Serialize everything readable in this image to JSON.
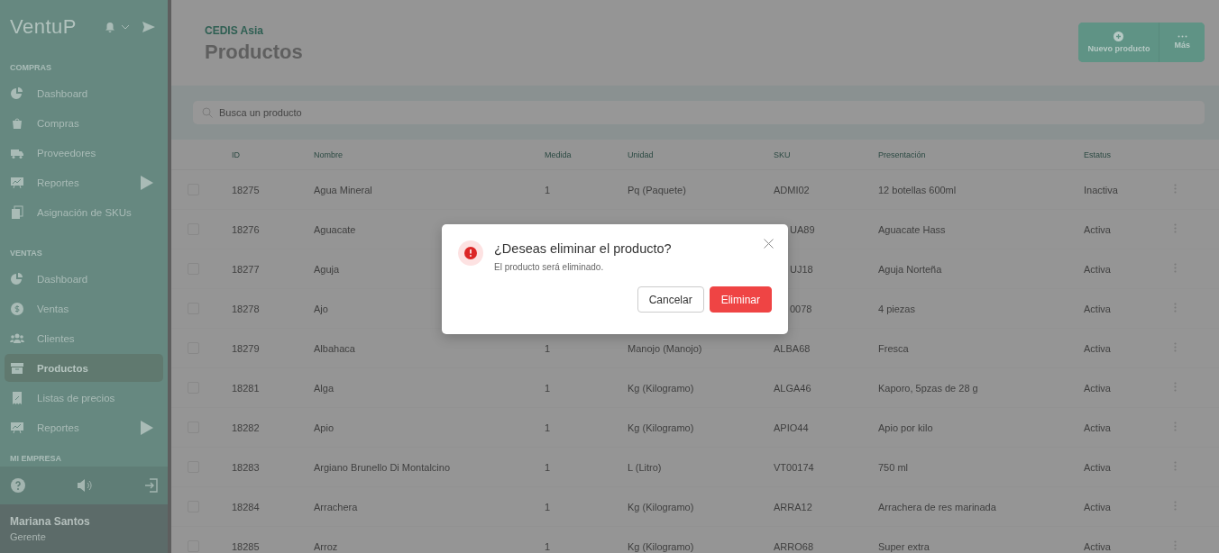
{
  "sidebar": {
    "logo": "VentuP",
    "sections": [
      {
        "title": "COMPRAS",
        "items": [
          {
            "label": "Dashboard",
            "selected": false,
            "submenu": false
          },
          {
            "label": "Compras",
            "selected": false,
            "submenu": false
          },
          {
            "label": "Proveedores",
            "selected": false,
            "submenu": false
          },
          {
            "label": "Reportes",
            "selected": false,
            "submenu": true
          },
          {
            "label": "Asignación de SKUs",
            "selected": false,
            "submenu": false
          }
        ]
      },
      {
        "title": "VENTAS",
        "items": [
          {
            "label": "Dashboard",
            "selected": false,
            "submenu": false
          },
          {
            "label": "Ventas",
            "selected": false,
            "submenu": false
          },
          {
            "label": "Clientes",
            "selected": false,
            "submenu": false
          },
          {
            "label": "Productos",
            "selected": true,
            "submenu": false
          },
          {
            "label": "Listas de precios",
            "selected": false,
            "submenu": false
          },
          {
            "label": "Reportes",
            "selected": false,
            "submenu": true
          }
        ]
      },
      {
        "title": "MI EMPRESA"
      }
    ],
    "user": {
      "name": "Mariana Santos",
      "role": "Gerente"
    }
  },
  "header": {
    "subtitle": "CEDIS Asia",
    "title": "Productos",
    "actions": [
      {
        "label": "Nuevo producto"
      },
      {
        "label": "Más"
      }
    ]
  },
  "search": {
    "placeholder": "Busca un producto"
  },
  "table": {
    "columns": [
      "ID",
      "Nombre",
      "Medida",
      "Unidad",
      "SKU",
      "Presentación",
      "Estatus"
    ],
    "rows": [
      {
        "checked": false,
        "cells": [
          "18275",
          "Agua Mineral",
          "1",
          "Pq (Paquete)",
          "ADMI02",
          "12 botellas 600ml",
          "Inactiva"
        ]
      },
      {
        "checked": false,
        "covered": true,
        "cells": [
          "18276",
          "Aguacate",
          null,
          null,
          "UA89",
          "Aguacate Hass",
          "Activa"
        ]
      },
      {
        "checked": false,
        "covered": true,
        "cells": [
          "18277",
          "Aguja",
          null,
          null,
          "UJ18",
          "Aguja Norteña",
          "Activa"
        ]
      },
      {
        "checked": false,
        "covered": true,
        "cells": [
          "18278",
          "Ajo",
          null,
          null,
          "0078",
          "4 piezas",
          "Activa"
        ]
      },
      {
        "checked": false,
        "cells": [
          "18279",
          "Albahaca",
          "1",
          "Manojo (Manojo)",
          "ALBA68",
          "Fresca",
          "Activa"
        ]
      },
      {
        "checked": false,
        "cells": [
          "18281",
          "Alga",
          "1",
          "Kg (Kilogramo)",
          "ALGA46",
          "Kaporo, 5pzas de 28 g",
          "Activa"
        ]
      },
      {
        "checked": false,
        "cells": [
          "18282",
          "Apio",
          "1",
          "Kg (Kilogramo)",
          "APIO44",
          "Apio por kilo",
          "Activa"
        ]
      },
      {
        "checked": false,
        "cells": [
          "18283",
          "Argiano Brunello Di Montalcino",
          "1",
          "L (Litro)",
          "VT00174",
          "750 ml",
          "Activa"
        ]
      },
      {
        "checked": false,
        "cells": [
          "18284",
          "Arrachera",
          "1",
          "Kg (Kilogramo)",
          "ARRA12",
          "Arrachera de res marinada",
          "Activa"
        ]
      },
      {
        "checked": false,
        "cells": [
          "18285",
          "Arroz",
          "1",
          "Kg (Kilogramo)",
          "ARRO68",
          "Super extra",
          "Activa"
        ]
      }
    ]
  },
  "dialog": {
    "title": "¿Deseas eliminar el producto?",
    "message": "El producto será eliminado.",
    "buttons": [
      {
        "label": "Cancelar",
        "kind": "secondary"
      },
      {
        "label": "Eliminar",
        "kind": "danger"
      }
    ]
  }
}
